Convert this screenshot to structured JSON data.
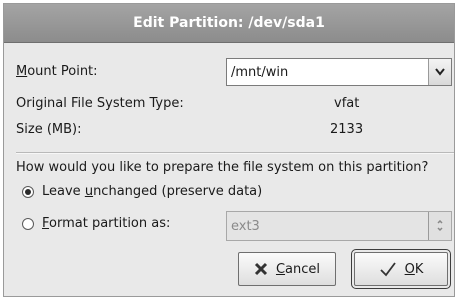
{
  "window": {
    "title": "Edit Partition: /dev/sda1"
  },
  "mount_point": {
    "label_first": "M",
    "label_rest": "ount Point:",
    "value": "/mnt/win"
  },
  "info": {
    "fs_type_label": "Original File System Type:",
    "fs_type_value": "vfat",
    "size_label": "Size (MB):",
    "size_value": "2133"
  },
  "prepare": {
    "question": "How would you like to prepare the file system on this partition?",
    "leave_before": "Leave ",
    "leave_mnemonic": "u",
    "leave_after": "nchanged (preserve data)",
    "leave_selected": true,
    "format_mnemonic": "F",
    "format_after": "ormat partition as:",
    "format_selected": false,
    "format_type": "ext3"
  },
  "buttons": {
    "cancel_mnemonic": "C",
    "cancel_rest": "ancel",
    "ok_mnemonic": "O",
    "ok_rest": "K"
  },
  "icons": {
    "dropdown": "chevron-down-icon",
    "cancel": "cancel-x-icon",
    "ok": "checkmark-icon"
  }
}
